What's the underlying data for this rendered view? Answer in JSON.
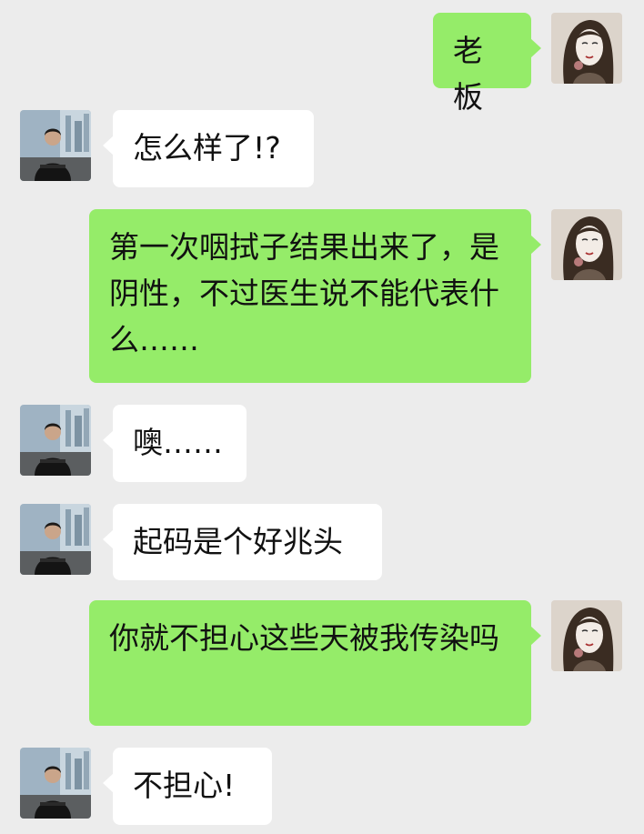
{
  "colors": {
    "background": "#ececec",
    "outgoing_bubble": "#95ec69",
    "incoming_bubble": "#ffffff",
    "text": "#111111"
  },
  "avatars": {
    "incoming": "man-in-black-shirt-by-window-avatar",
    "outgoing": "woman-sketch-portrait-avatar"
  },
  "messages": [
    {
      "side": "outgoing",
      "text": "老板"
    },
    {
      "side": "incoming",
      "text": "怎么样了!?"
    },
    {
      "side": "outgoing",
      "text": "第一次咽拭子结果出来了，是阴性，不过医生说不能代表什么……"
    },
    {
      "side": "incoming",
      "text": "噢……"
    },
    {
      "side": "incoming",
      "text": "起码是个好兆头"
    },
    {
      "side": "outgoing",
      "text": "你就不担心这些天被我传染吗"
    },
    {
      "side": "incoming",
      "text": "不担心!"
    }
  ]
}
